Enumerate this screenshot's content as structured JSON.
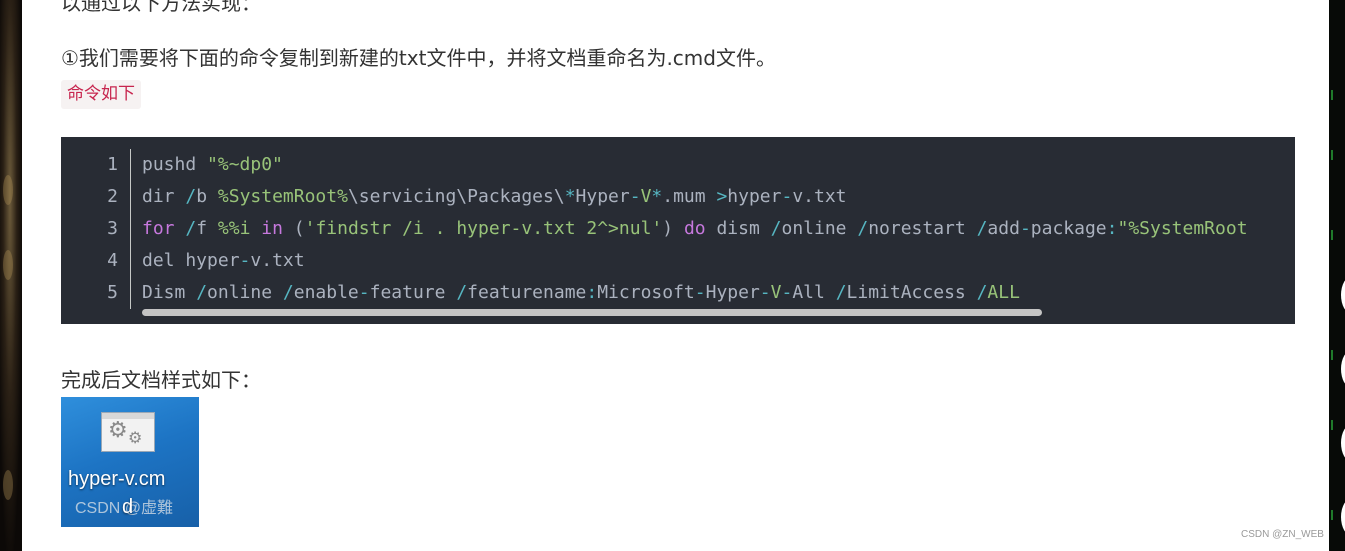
{
  "article": {
    "cut_line": "以通过以下方法实现：",
    "step1": "①我们需要将下面的命令复制到新建的txt文件中，并将文档重命名为.cmd文件。",
    "inline_code": "命令如下",
    "done_label": "完成后文档样式如下："
  },
  "code": {
    "line_numbers": [
      "1",
      "2",
      "3",
      "4",
      "5"
    ],
    "lines": [
      "pushd \"%~dp0\"",
      "dir /b %SystemRoot%\\servicing\\Packages\\*Hyper-V*.mum >hyper-v.txt",
      "for /f %%i in ('findstr /i . hyper-v.txt 2^>nul') do dism /online /norestart /add-package:\"%SystemRoot",
      "del hyper-v.txt",
      "Dism /online /enable-feature /featurename:Microsoft-Hyper-V-All /LimitAccess /ALL"
    ]
  },
  "file_icon": {
    "name_line1": "hyper-v.cm",
    "name_line2": "d",
    "watermark": "CSDN @虚難"
  },
  "page_watermark": "CSDN @ZN_WEB",
  "icons": {
    "file_icon": "cmd-file-icon",
    "gear": "gear-icon"
  }
}
